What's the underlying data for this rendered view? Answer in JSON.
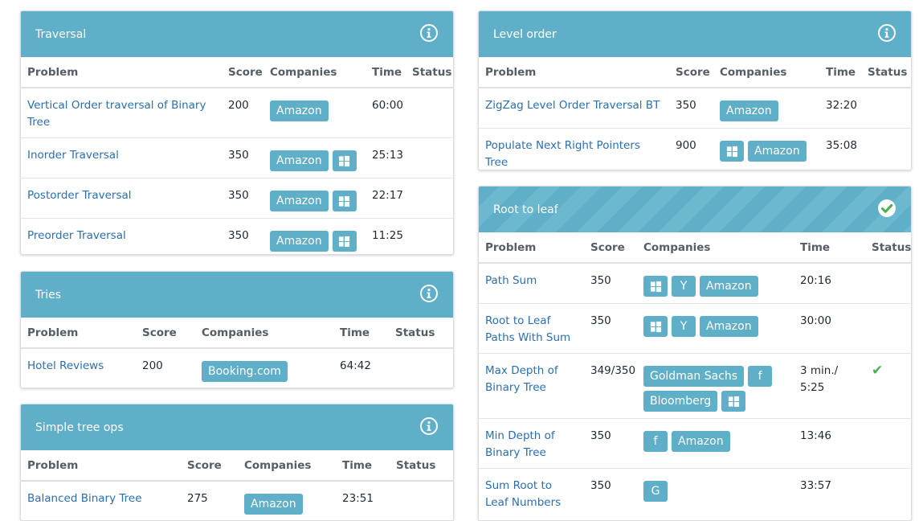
{
  "headers": {
    "problem": "Problem",
    "score": "Score",
    "companies": "Companies",
    "time": "Time",
    "status": "Status"
  },
  "panels": [
    {
      "title": "Traversal",
      "header_icon": "info-icon",
      "striped": false,
      "rows": [
        {
          "problem": "Vertical Order traversal of Binary Tree",
          "score": "200",
          "time": "60:00",
          "status": "",
          "companies": [
            {
              "label": "Amazon"
            }
          ]
        },
        {
          "problem": "Inorder Traversal",
          "score": "350",
          "time": "25:13",
          "status": "",
          "companies": [
            {
              "label": "Amazon"
            },
            {
              "icon": "windows-icon"
            }
          ]
        },
        {
          "problem": "Postorder Traversal",
          "score": "350",
          "time": "22:17",
          "status": "",
          "companies": [
            {
              "label": "Amazon"
            },
            {
              "icon": "windows-icon"
            }
          ]
        },
        {
          "problem": "Preorder Traversal",
          "score": "350",
          "time": "11:25",
          "status": "",
          "companies": [
            {
              "label": "Amazon"
            },
            {
              "icon": "windows-icon"
            }
          ]
        }
      ]
    },
    {
      "title": "Tries",
      "header_icon": "info-icon",
      "striped": false,
      "rows": [
        {
          "problem": "Hotel Reviews",
          "score": "200",
          "time": "64:42",
          "status": "",
          "companies": [
            {
              "label": "Booking.com"
            }
          ]
        }
      ]
    },
    {
      "title": "Simple tree ops",
      "header_icon": "info-icon",
      "striped": false,
      "rows": [
        {
          "problem": "Balanced Binary Tree",
          "score": "275",
          "time": "23:51",
          "status": "",
          "companies": [
            {
              "label": "Amazon"
            }
          ]
        }
      ]
    },
    {
      "title": "Level order",
      "header_icon": "info-icon",
      "striped": false,
      "rows": [
        {
          "problem": "ZigZag Level Order Traversal BT",
          "score": "350",
          "time": "32:20",
          "status": "",
          "companies": [
            {
              "label": "Amazon"
            }
          ]
        },
        {
          "problem": "Populate Next Right Pointers Tree",
          "score": "900",
          "time": "35:08",
          "status": "",
          "companies": [
            {
              "icon": "windows-icon"
            },
            {
              "label": "Amazon"
            }
          ]
        }
      ]
    },
    {
      "title": "Root to leaf",
      "header_icon": "check-circle-icon",
      "striped": true,
      "rows": [
        {
          "problem": "Path Sum",
          "score": "350",
          "time": "20:16",
          "status": "",
          "companies": [
            {
              "icon": "windows-icon"
            },
            {
              "icon": "yahoo-icon",
              "text": "Y"
            },
            {
              "label": "Amazon"
            }
          ]
        },
        {
          "problem": "Root to Leaf Paths With Sum",
          "score": "350",
          "time": "30:00",
          "status": "",
          "companies": [
            {
              "icon": "windows-icon"
            },
            {
              "icon": "yahoo-icon",
              "text": "Y"
            },
            {
              "label": "Amazon"
            }
          ]
        },
        {
          "problem": "Max Depth of Binary Tree",
          "score": "349/350",
          "time": "3 min./ 5:25",
          "status": "solved",
          "companies": [
            {
              "label": "Goldman Sachs"
            },
            {
              "icon": "facebook-icon",
              "text": "f"
            },
            {
              "label": "Bloomberg"
            },
            {
              "icon": "windows-icon"
            }
          ]
        },
        {
          "problem": "Min Depth of Binary Tree",
          "score": "350",
          "time": "13:46",
          "status": "",
          "companies": [
            {
              "icon": "facebook-icon",
              "text": "f"
            },
            {
              "label": "Amazon"
            }
          ]
        },
        {
          "problem": "Sum Root to Leaf Numbers",
          "score": "350",
          "time": "33:57",
          "status": "",
          "companies": [
            {
              "icon": "google-icon",
              "text": "G"
            }
          ]
        }
      ]
    }
  ]
}
